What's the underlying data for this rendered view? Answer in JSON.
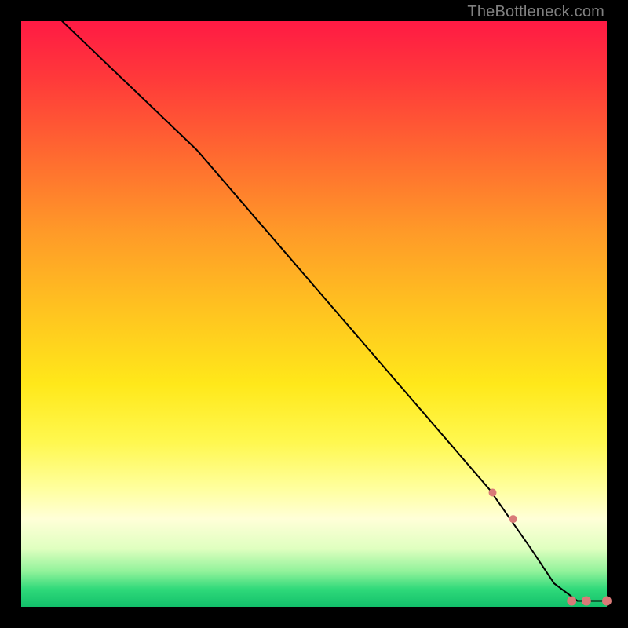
{
  "watermark": "TheBottleneck.com",
  "chart_data": {
    "type": "line",
    "title": "",
    "xlabel": "",
    "ylabel": "",
    "xlim": [
      0,
      100
    ],
    "ylim": [
      0,
      100
    ],
    "grid": false,
    "background": "rainbow-vertical",
    "series": [
      {
        "name": "curve",
        "x": [
          7,
          30,
          80,
          87,
          91,
          95,
          100
        ],
        "y": [
          100,
          78,
          20,
          10,
          4,
          1,
          1
        ]
      }
    ],
    "markers": [
      {
        "kind": "pill",
        "x1": 77,
        "y1": 24,
        "x2": 80,
        "y2": 20,
        "r": 6.5
      },
      {
        "kind": "dot",
        "x": 80.5,
        "y": 19.5,
        "r": 5
      },
      {
        "kind": "pill",
        "x1": 81,
        "y1": 18.5,
        "x2": 83,
        "y2": 16,
        "r": 6.5
      },
      {
        "kind": "dot",
        "x": 84,
        "y": 15,
        "r": 5
      },
      {
        "kind": "pill",
        "x1": 84.5,
        "y1": 14,
        "x2": 86.5,
        "y2": 11,
        "r": 6.5
      },
      {
        "kind": "pill",
        "x1": 87,
        "y1": 10,
        "x2": 89,
        "y2": 7,
        "r": 6.5
      },
      {
        "kind": "pill",
        "x1": 90,
        "y1": 5,
        "x2": 92,
        "y2": 2.5,
        "r": 6.5
      },
      {
        "kind": "dot",
        "x": 94,
        "y": 1,
        "r": 6
      },
      {
        "kind": "dot",
        "x": 96.5,
        "y": 1,
        "r": 6
      },
      {
        "kind": "dot",
        "x": 100,
        "y": 1,
        "r": 6
      }
    ],
    "colors": {
      "curve": "#000000",
      "marker": "#d97a78"
    }
  }
}
